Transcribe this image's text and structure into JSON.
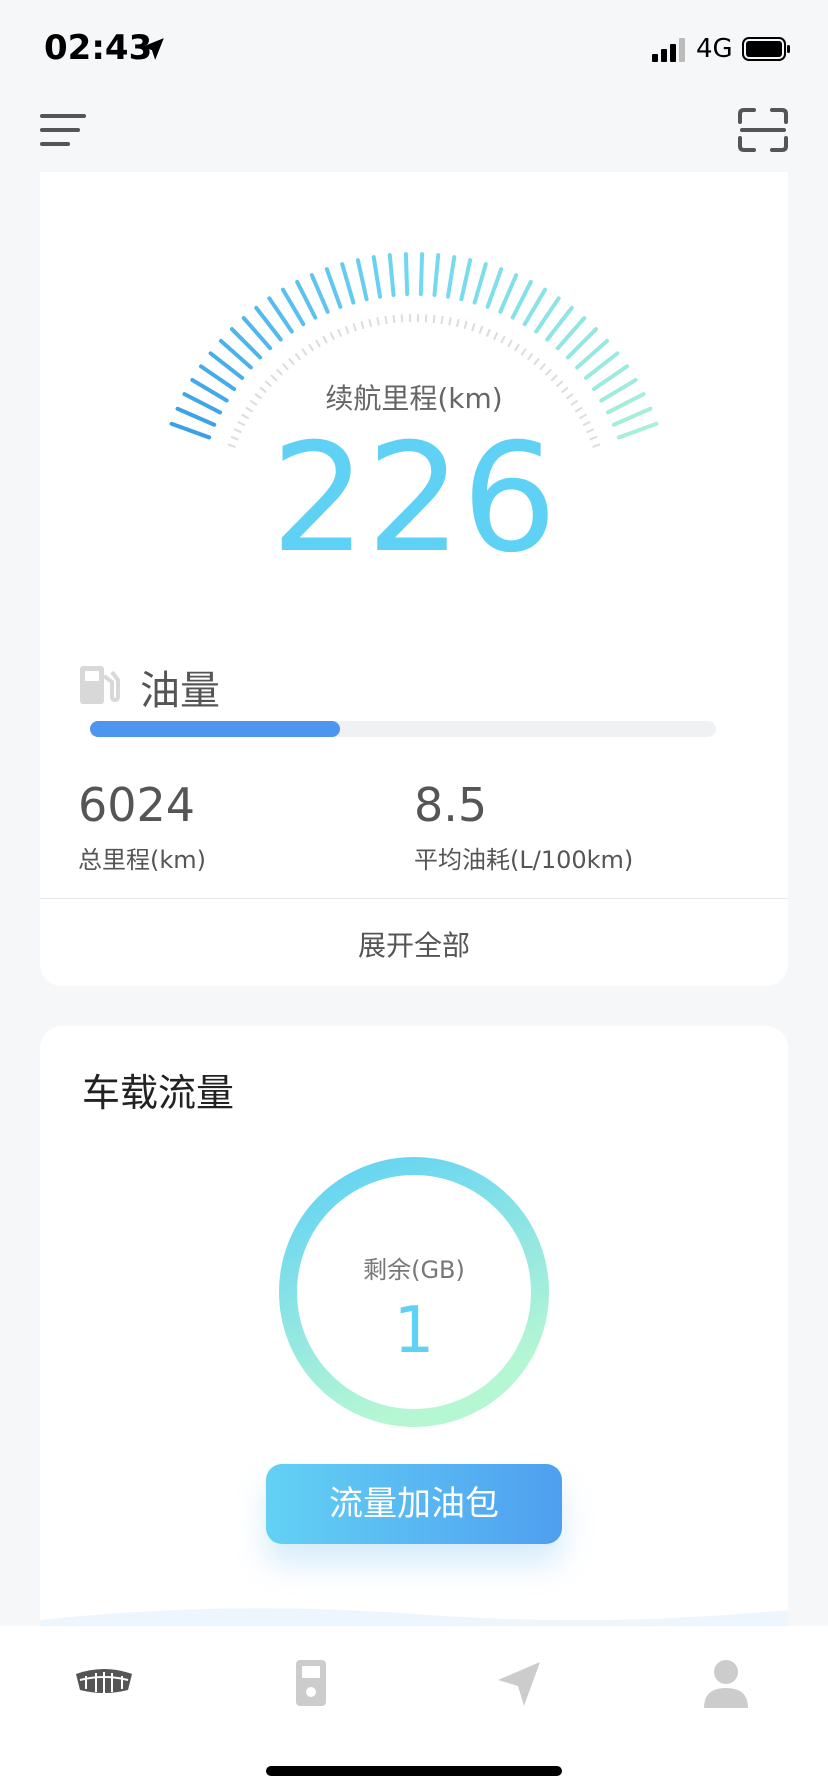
{
  "status_bar": {
    "time": "02:43",
    "network": "4G"
  },
  "range": {
    "label": "续航里程(km)",
    "value": "226"
  },
  "fuel": {
    "label": "油量",
    "level_percent": 40
  },
  "stats": [
    {
      "value": "6024",
      "label": "总里程(km)"
    },
    {
      "value": "8.5",
      "label": "平均油耗(L/100km)"
    }
  ],
  "expand_label": "展开全部",
  "data_card": {
    "title": "车载流量",
    "remaining_label": "剩余(GB)",
    "remaining_value": "1",
    "button_label": "流量加油包"
  },
  "tabs": [
    {
      "icon": "car-grille-icon",
      "active": true
    },
    {
      "icon": "fuel-pump-icon",
      "active": false
    },
    {
      "icon": "navigation-icon",
      "active": false
    },
    {
      "icon": "user-icon",
      "active": false
    }
  ],
  "colors": {
    "accent": "#5fd1f5",
    "fuel_bar": "#4d95ee",
    "button_start": "#63d1f4",
    "button_end": "#4f9ff0",
    "ring_end": "#b6f7d3"
  }
}
